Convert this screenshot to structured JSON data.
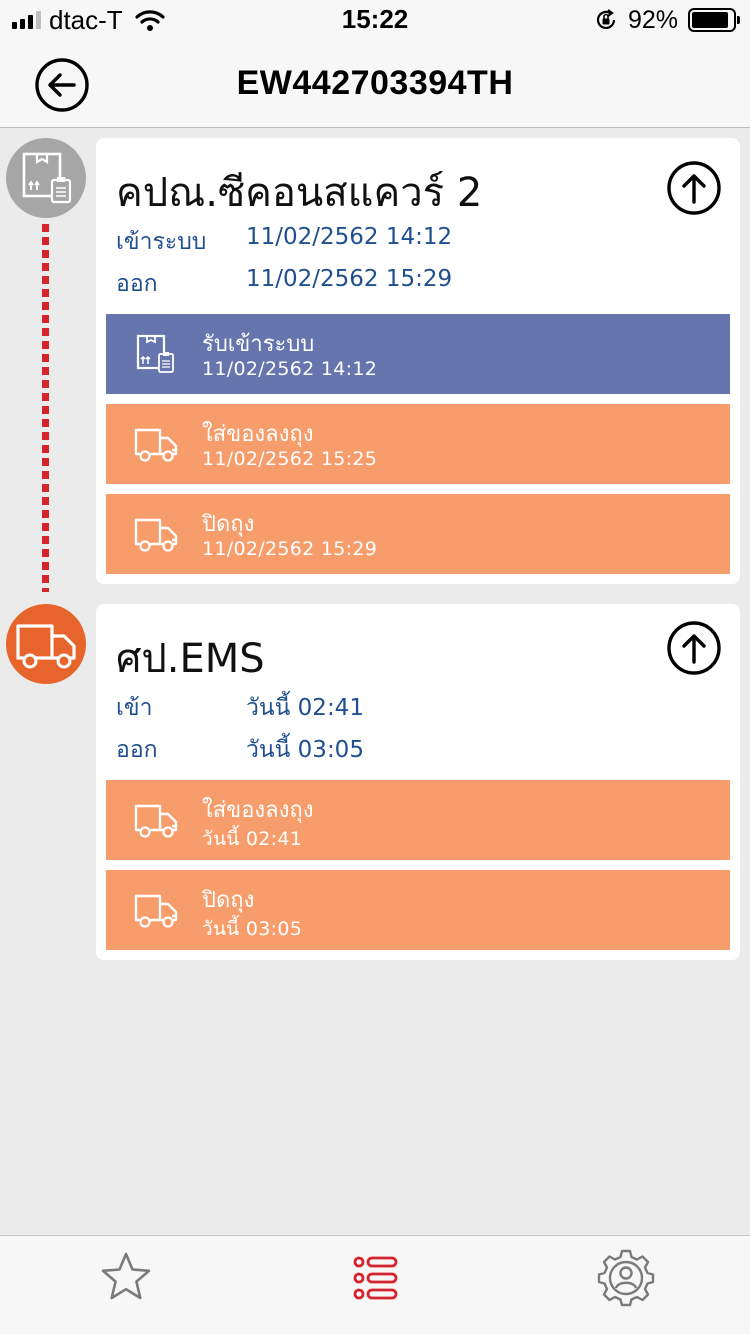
{
  "status_bar": {
    "carrier": "dtac-T",
    "time": "15:22",
    "battery": "92%"
  },
  "nav": {
    "title": "EW442703394TH",
    "back_icon": "arrow-left-circle-icon"
  },
  "offices": [
    {
      "name": "คปณ.ซีคอนสแควร์ 2",
      "node_color": "#a6a6a6",
      "node_icon": "parcel-clipboard-icon",
      "in_label": "เข้าระบบ",
      "in_value": "11/02/2562 14:12",
      "out_label": "ออก",
      "out_value": "11/02/2562 15:29",
      "events": [
        {
          "title": "รับเข้าระบบ",
          "time": "11/02/2562 14:12",
          "icon": "parcel-clipboard-icon",
          "color": "#6675ad"
        },
        {
          "title": "ใส่ของลงถุง",
          "time": "11/02/2562 15:25",
          "icon": "truck-icon",
          "color": "#f79d6b"
        },
        {
          "title": "ปิดถุง",
          "time": "11/02/2562 15:29",
          "icon": "truck-icon",
          "color": "#f79d6b"
        }
      ]
    },
    {
      "name": "ศป.EMS",
      "node_color": "#e8642d",
      "node_icon": "truck-icon",
      "in_label": "เข้า",
      "in_value": "วันนี้ 02:41",
      "out_label": "ออก",
      "out_value": "วันนี้ 03:05",
      "events": [
        {
          "title": "ใส่ของลงถุง",
          "time": "วันนี้ 02:41",
          "icon": "truck-icon",
          "color": "#f79d6b"
        },
        {
          "title": "ปิดถุง",
          "time": "วันนี้ 03:05",
          "icon": "truck-icon",
          "color": "#f79d6b"
        }
      ]
    }
  ],
  "tab_bar": {
    "items": [
      {
        "icon": "star-icon",
        "active": false
      },
      {
        "icon": "list-icon",
        "active": true,
        "color": "#d6232c"
      },
      {
        "icon": "settings-user-icon",
        "active": false
      }
    ]
  },
  "colors": {
    "accent_red": "#d6232c",
    "info_text": "#1f4f8f"
  }
}
